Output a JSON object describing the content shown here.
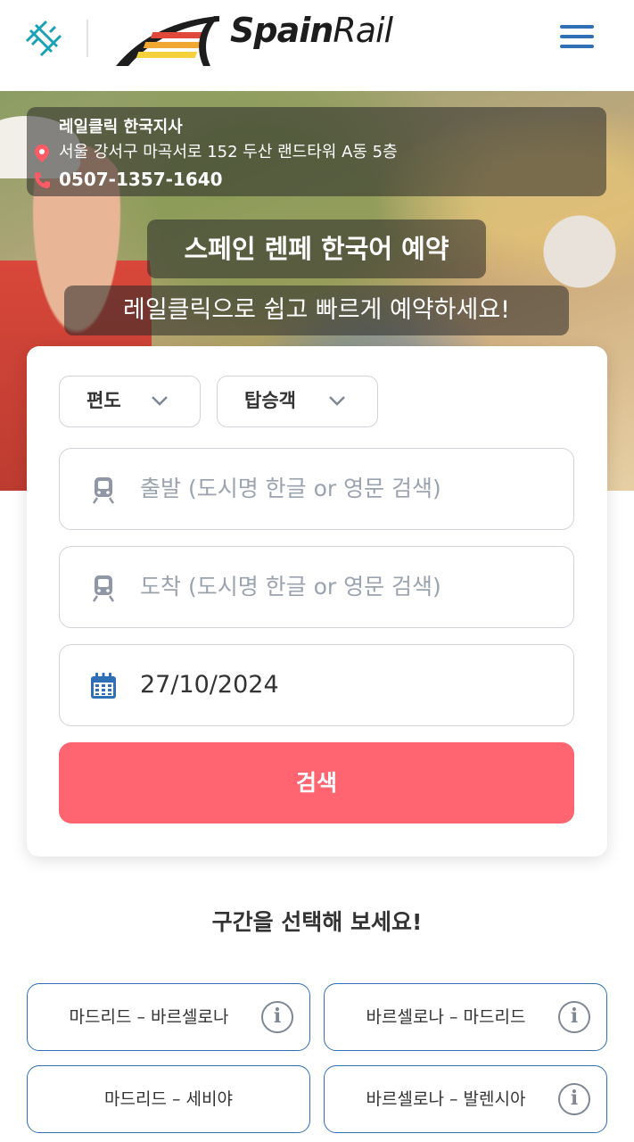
{
  "header": {
    "logo_bold": "Spain",
    "logo_light": "Rail",
    "brand_colors": {
      "stripe_red": "#e0483a",
      "stripe_orange": "#f0a830",
      "stripe_yellow": "#f5d23c",
      "arc": "#1d1d1d"
    },
    "icon_color": "#1aa1b5",
    "menu_icon": "hamburger-menu-icon"
  },
  "hero": {
    "office_name": "레일클릭 한국지사",
    "address": "서울 강서구 마곡서로 152 두산 랜드타워 A동 5층",
    "phone": "0507-1357-1640",
    "title": "스페인 렌페 한국어 예약",
    "subtitle": "레일클릭으로 쉽고 빠르게 예약하세요!"
  },
  "search": {
    "trip_type": "편도",
    "passengers": "탑승객",
    "from_placeholder": "출발 (도시명 한글 or 영문 검색)",
    "to_placeholder": "도착 (도시명 한글 or 영문 검색)",
    "date": "27/10/2024",
    "button": "검색",
    "button_color": "#fe6571"
  },
  "routes": {
    "title": "구간을 선택해 보세요!",
    "items": [
      {
        "label": "마드리드 – 바르셀로나",
        "info": "i"
      },
      {
        "label": "바르셀로나 – 마드리드",
        "info": "i"
      },
      {
        "label": "마드리드 – 세비야"
      },
      {
        "label": "바르셀로나 – 발렌시아",
        "info": "i"
      }
    ],
    "border_color": "#2f6fb5"
  }
}
